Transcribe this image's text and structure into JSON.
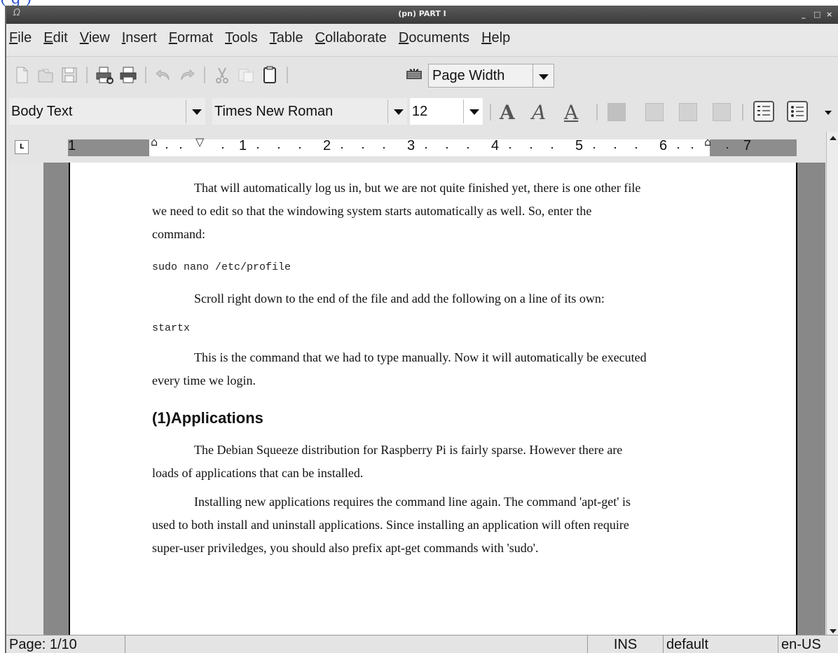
{
  "top_fragment": "(      g         )",
  "window": {
    "title": "(pn) PART I",
    "controls": [
      "_",
      "□",
      "×"
    ]
  },
  "menu": [
    "File",
    "Edit",
    "View",
    "Insert",
    "Format",
    "Tools",
    "Table",
    "Collaborate",
    "Documents",
    "Help"
  ],
  "toolbar": {
    "icons": [
      "new-document-icon",
      "open-icon",
      "save-icon",
      "print-preview-icon",
      "print-icon",
      "undo-icon",
      "redo-icon",
      "cut-icon",
      "copy-icon",
      "paste-icon",
      "zoom-icon"
    ],
    "zoom_value": "Page Width"
  },
  "format_toolbar": {
    "paragraph_style": "Body Text",
    "font_family": "Times New Roman",
    "font_size": "12",
    "format_buttons": [
      "A",
      "A",
      "A"
    ]
  },
  "ruler": {
    "numbers": [
      "1",
      "1",
      "2",
      "3",
      "4",
      "5",
      "6",
      "7"
    ]
  },
  "document": {
    "paragraphs": [
      {
        "first": "That will automatically log us in, but we are not quite finished yet, there is one other file",
        "rest": [
          "we need to edit so that the windowing system starts automatically as well. So, enter the",
          "command:"
        ]
      },
      {
        "first": "Scroll right down to the end of the file and add the following on a line of its own:",
        "rest": []
      },
      {
        "first": "This is the command that we had to type manually. Now it will automatically be executed",
        "rest": [
          "every time we login."
        ]
      },
      {
        "first": "The Debian Squeeze distribution for Raspberry Pi is fairly sparse. However there are",
        "rest": [
          "loads of applications that can be installed."
        ]
      },
      {
        "first": "Installing new applications requires the command line again. The command 'apt-get' is",
        "rest": [
          "used to both install and uninstall applications. Since installing an application will often require",
          "super-user priviledges, you should also prefix apt-get commands with 'sudo'."
        ]
      }
    ],
    "code1": "sudo nano /etc/profile",
    "code2": "startx",
    "heading": "(1)Applications"
  },
  "statusbar": {
    "page": "Page: 1/10",
    "mode": "INS",
    "style": "default",
    "language": "en-US"
  }
}
